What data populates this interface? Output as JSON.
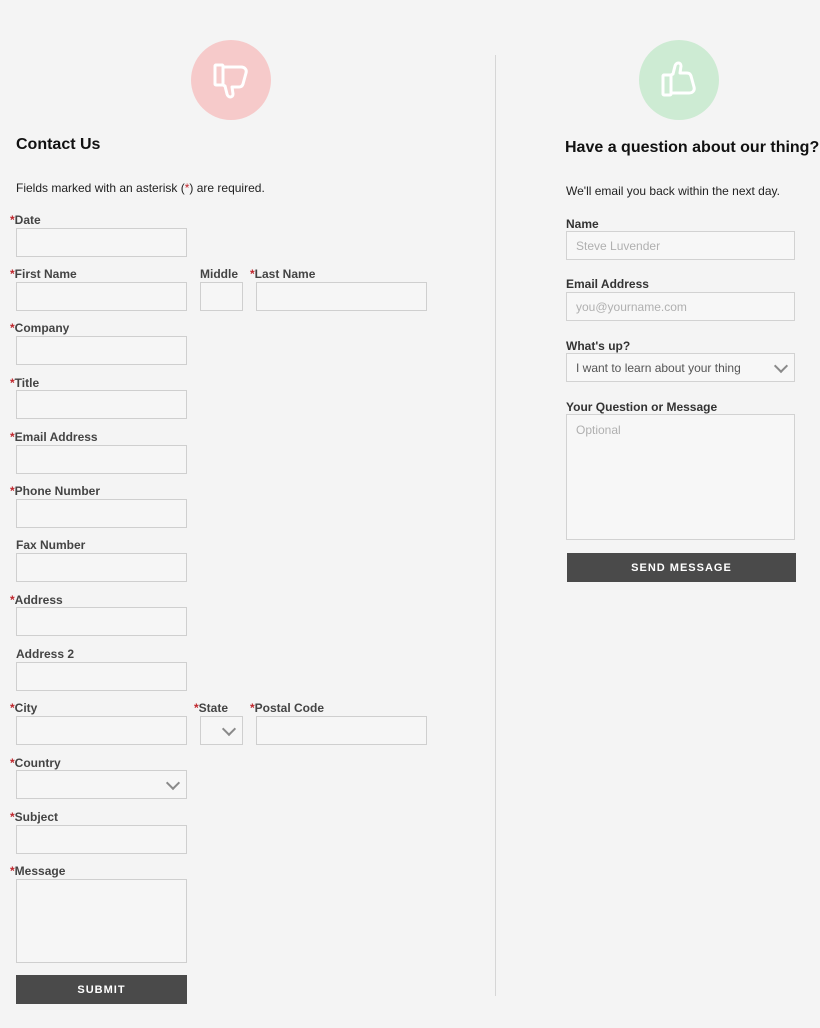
{
  "left": {
    "title": "Contact Us",
    "note_before": "Fields marked with an asterisk (",
    "note_asterisk": "*",
    "note_after": ") are required.",
    "required_marker": "*",
    "fields": {
      "date": "Date",
      "first_name": "First Name",
      "middle": "Middle",
      "last_name": "Last Name",
      "company": "Company",
      "title": "Title",
      "email": "Email Address",
      "phone": "Phone Number",
      "fax": "Fax Number",
      "address": "Address",
      "address2": "Address 2",
      "city": "City",
      "state": "State",
      "postal": "Postal Code",
      "country": "Country",
      "subject": "Subject",
      "message": "Message"
    },
    "submit_label": "SUBMIT"
  },
  "right": {
    "title": "Have a question about our thing?",
    "note": "We'll email you back within the next day.",
    "name_label": "Name",
    "name_placeholder": "Steve Luvender",
    "email_label": "Email Address",
    "email_placeholder": "you@yourname.com",
    "whatsup_label": "What's up?",
    "whatsup_selected": "I want to learn about your thing",
    "message_label": "Your Question or Message",
    "message_placeholder": "Optional",
    "send_label": "SEND MESSAGE"
  },
  "icons": {
    "left": "thumbs-down-icon",
    "right": "thumbs-up-icon"
  },
  "colors": {
    "required": "#c0272d",
    "thumbs_down_bg": "#f6caca",
    "thumbs_up_bg": "#cdebd3",
    "button": "#4a4a4a"
  }
}
